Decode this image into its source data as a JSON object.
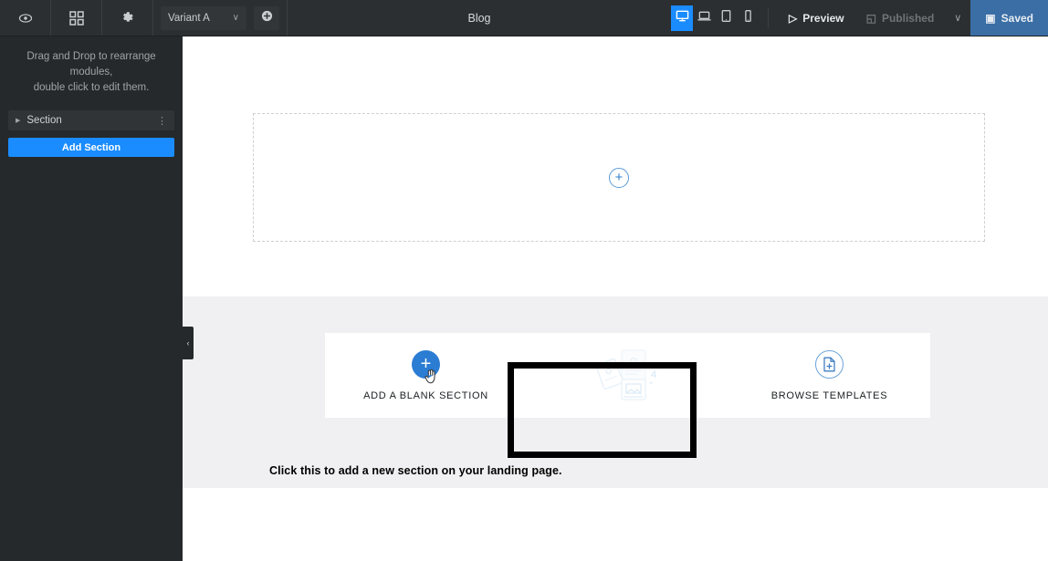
{
  "topbar": {
    "icons": [
      {
        "name": "preview-eye-icon",
        "label": "Preview"
      },
      {
        "name": "grid-modules-icon",
        "label": "Modules"
      },
      {
        "name": "settings-gear-icon",
        "label": "Settings"
      }
    ],
    "variant_label": "Variant A",
    "variant_chevron": "∨",
    "add_variant_label": "+",
    "page_title": "Blog",
    "devices": [
      {
        "name": "desktop",
        "active": true
      },
      {
        "name": "laptop",
        "active": false
      },
      {
        "name": "tablet",
        "active": false
      },
      {
        "name": "mobile",
        "active": false
      }
    ],
    "preview_label": "Preview",
    "preview_glyph": "▷",
    "published_label": "Published",
    "published_glyph": "◱",
    "dropdown_caret": "∨",
    "saved_label": "Saved",
    "saved_glyph": "▣",
    "accent_color": "#1a8cff",
    "saved_color": "#3a6ea5",
    "bar_color": "#2b2f31"
  },
  "sidebar": {
    "hint_line1": "Drag and Drop to rearrange modules,",
    "hint_line2": "double click to edit them.",
    "module": {
      "triangle": "▶",
      "label": "Section",
      "menu_glyph": "⋮"
    },
    "add_section_label": "Add Section",
    "background": "#26292b"
  },
  "canvas": {
    "collapse_glyph": "‹",
    "dropzone_plus": "+",
    "band_color": "#f0f0f2",
    "section_card": {
      "options": [
        {
          "id": "add-blank-section",
          "label": "ADD A BLANK SECTION",
          "icon": "blue-plus-icon",
          "icon_glyph": "+",
          "highlighted": true
        },
        {
          "id": "template-cluster",
          "label": "",
          "icon": "template-cluster-icon",
          "highlighted": false
        },
        {
          "id": "browse-templates",
          "label": "BROWSE TEMPLATES",
          "icon": "document-add-icon",
          "highlighted": false
        }
      ]
    },
    "caption": "Click this to add a new section on your landing page.",
    "highlight_color": "#000000",
    "blue_button_color": "#2b7cd3"
  }
}
